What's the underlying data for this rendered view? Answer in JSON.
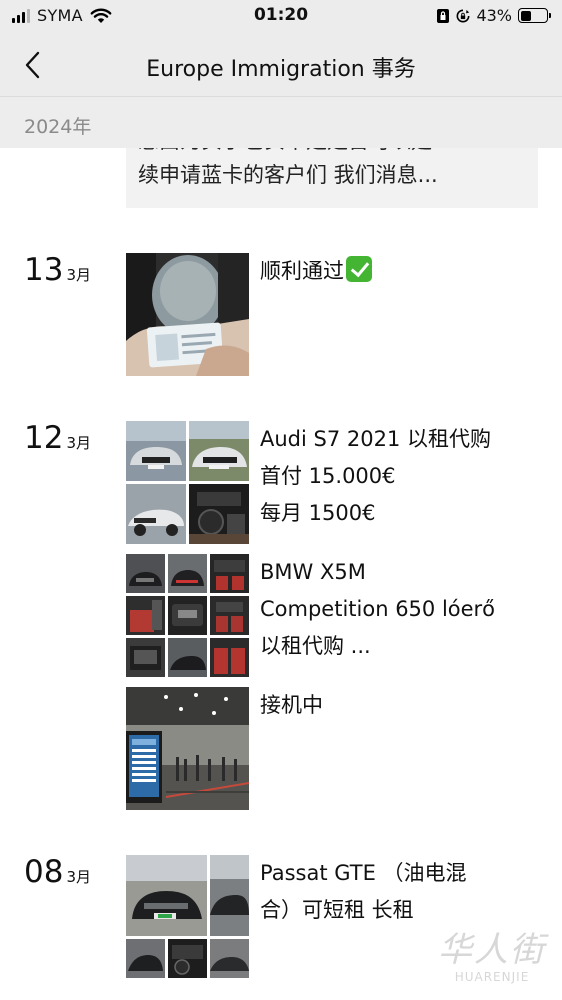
{
  "status_bar": {
    "carrier": "SYMA",
    "time": "01:20",
    "battery": "43%",
    "battery_level": 0.43
  },
  "nav": {
    "title": "Europe Immigration 事务",
    "back_icon": "chevron-left-icon"
  },
  "year_header": "2024年",
  "partial_post": {
    "line1": "恋由为实于也实不是是否可以延",
    "line2": "续申请蓝卡的客户们 我们消息..."
  },
  "days": [
    {
      "day": "13",
      "month": "3月",
      "posts": [
        {
          "lines": [
            "顺利通过"
          ],
          "emoji": "check-mark-button-icon",
          "image": "photo-card-in-hand"
        }
      ]
    },
    {
      "day": "12",
      "month": "3月",
      "posts": [
        {
          "lines": [
            "Audi S7 2021 以租代购",
            "首付 15.000€",
            "每月 1500€"
          ],
          "image": "grid-4-audi"
        },
        {
          "lines": [
            "BMW X5M",
            "Competition 650 lóerő",
            "以租代购  ..."
          ],
          "image": "grid-9-bmw"
        },
        {
          "lines": [
            "接机中"
          ],
          "image": "photo-airport"
        }
      ]
    },
    {
      "day": "08",
      "month": "3月",
      "posts": [
        {
          "lines": [
            "Passat GTE （油电混",
            "合）可短租 长租"
          ],
          "image": "grid-4-passat"
        }
      ]
    }
  ],
  "watermark": {
    "cn": "华人街",
    "en": "HUARENJIE"
  }
}
